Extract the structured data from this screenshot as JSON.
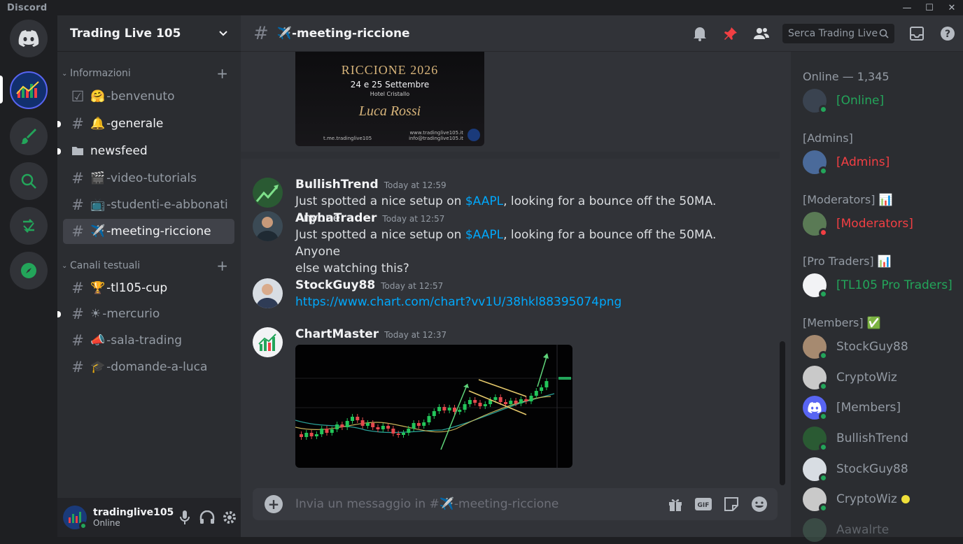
{
  "app": {
    "title": "Discord"
  },
  "window_controls": {
    "minimize": "—",
    "maximize": "☐",
    "close": "✕"
  },
  "server": {
    "name": "Trading Live 105"
  },
  "sidebar": {
    "categories": [
      {
        "label": "Informazioni"
      },
      {
        "label": "Canali testuali"
      }
    ],
    "channels": [
      {
        "icon": "☑",
        "emoji": "🤗",
        "label": "-benvenuto"
      },
      {
        "icon": "#",
        "emoji": "🔔",
        "label": "-generale"
      },
      {
        "icon": "▬",
        "emoji": "",
        "label": "newsfeed"
      },
      {
        "icon": "#",
        "emoji": "🎬",
        "label": "-video-tutorials"
      },
      {
        "icon": "#",
        "emoji": "📺",
        "label": "-studenti-e-abbonati"
      },
      {
        "icon": "#",
        "emoji": "✈️",
        "label": "-meeting-riccione"
      },
      {
        "icon": "#",
        "emoji": "🏆",
        "label": "-tl105-cup"
      },
      {
        "icon": "#",
        "emoji": "☀",
        "label": "-mercurio"
      },
      {
        "icon": "#",
        "emoji": "📣",
        "label": "-sala-trading"
      },
      {
        "icon": "#",
        "emoji": "🎓",
        "label": "-domande-a-luca"
      }
    ]
  },
  "user": {
    "name": "tradinglive105",
    "status": "Online"
  },
  "channel_header": {
    "emoji": "✈️",
    "title": "-meeting-riccione",
    "search_placeholder": "Serca Trading Live"
  },
  "poster": {
    "title": "RICCIONE 2026",
    "dates": "24 e 25 Settembre",
    "venue": "Hotel Cristallo",
    "signature": "Luca Rossi",
    "footer_left": "t.me.tradinglive105",
    "footer_right_1": "www.tradinglive105.it",
    "footer_right_2": "info@tradinglive105.it"
  },
  "messages": [
    {
      "author": "BullishTrend",
      "time": "Today at 12:59",
      "pre": "Just spotted a nice setup on ",
      "link": "$AAPL",
      "post": ", looking for a bounce off the 50MA. Anyone"
    },
    {
      "author": "AlphaTrader",
      "time": "Today at 12:57",
      "pre": "Just spotted a nice setup on ",
      "link": "$AAPL",
      "post": ", looking for a bounce off the 50MA. Anyone",
      "line2": "else watching this?"
    },
    {
      "author": "StockGuy88",
      "time": "Today at 12:57",
      "link": "https://www.chart.com/chart?vv1U/38hkl88395074png"
    },
    {
      "author": "ChartMaster",
      "time": "Today at 12:37"
    }
  ],
  "composer": {
    "placeholder": "Invia un messaggio in #✈️-meeting-riccione"
  },
  "members": {
    "online_header": "Online — 1,345",
    "groups": [
      {
        "header": "",
        "items": [
          {
            "name": "[Online]",
            "color": "#23a55a"
          }
        ]
      },
      {
        "header": "[Admins]",
        "items": [
          {
            "name": "[Admins]",
            "color": "#f23f43"
          }
        ]
      },
      {
        "header": "[Moderators] 📊",
        "items": [
          {
            "name": "[Moderators]",
            "color": "#f23f43"
          }
        ]
      },
      {
        "header": "[Pro Traders] 📊",
        "items": [
          {
            "name": "[TL105 Pro Traders]",
            "color": "#23a55a"
          }
        ]
      },
      {
        "header": "[Members] ✅",
        "items": [
          {
            "name": "StockGuy88"
          },
          {
            "name": "CryptoWiz"
          },
          {
            "name": "[Members]"
          },
          {
            "name": "BullishTrend"
          },
          {
            "name": "StockGuy88"
          },
          {
            "name": "CryptoWiz"
          },
          {
            "name": "Aawalrte"
          }
        ]
      }
    ]
  },
  "colors": {
    "accent": "#5865f2",
    "online": "#23a55a",
    "dnd": "#f23f43",
    "idle": "#f0b232",
    "link": "#00a8fc"
  }
}
